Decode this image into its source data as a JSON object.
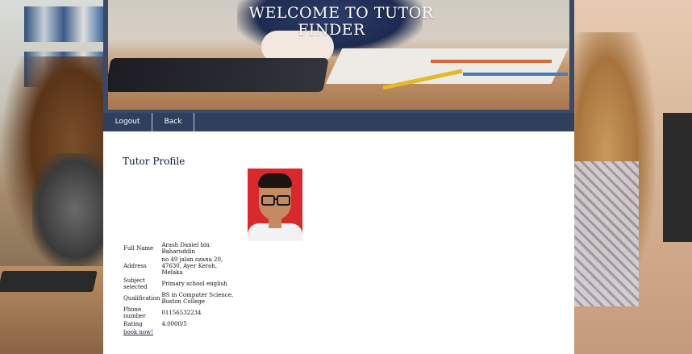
{
  "banner": {
    "title_line1": "WELCOME TO TUTOR",
    "title_line2": "FINDER"
  },
  "nav": {
    "logout": "Logout",
    "back": "Back"
  },
  "page": {
    "title": "Tutor Profile"
  },
  "profile": {
    "rows": [
      {
        "label": "Full Name",
        "value": "Arash Daniel bin Baharuddin"
      },
      {
        "label": "Address",
        "value": "no 49 jalan ozana 20, 47630, Ayer Keroh, Melaka"
      },
      {
        "label": "Subject selected",
        "value": "Primary school english"
      },
      {
        "label": "Qualification",
        "value": "BS in Computer Science, Boston College"
      },
      {
        "label": "Phone number",
        "value": "01156532234"
      },
      {
        "label": "Rating",
        "value": "4.0000/5"
      }
    ],
    "book_link": "book now!"
  },
  "colors": {
    "nav_bg": "#2f3f5e",
    "banner_frame": "#3a4a66",
    "title_color": "#0a1a3a"
  }
}
